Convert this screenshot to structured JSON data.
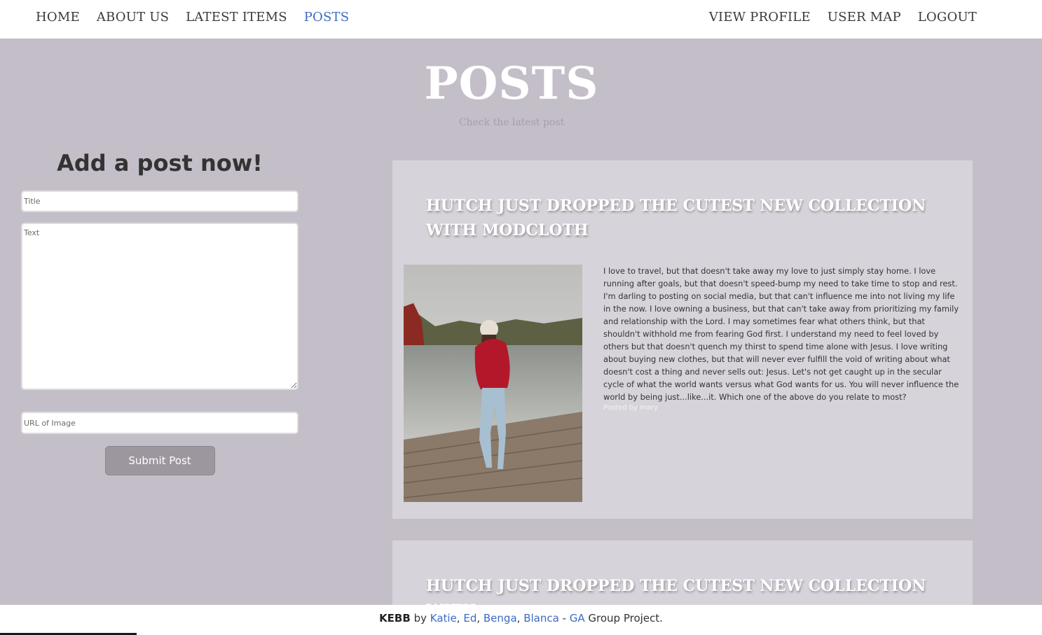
{
  "nav": {
    "left": [
      "HOME",
      "ABOUT US",
      "LATEST ITEMS",
      "POSTS"
    ],
    "right": [
      "VIEW PROFILE",
      "USER MAP",
      "LOGOUT"
    ],
    "active": "POSTS",
    "active_color": "#3c6ac6"
  },
  "hero": {
    "title": "POSTS",
    "subtitle": "Check the latest post"
  },
  "form": {
    "heading": "Add a post now!",
    "title_placeholder": "Title",
    "text_placeholder": "Text",
    "url_placeholder": "URL of Image",
    "submit_label": "Submit Post"
  },
  "posts": [
    {
      "title": "HUTCH JUST DROPPED THE CUTEST NEW COLLECTION WITH MODCLOTH",
      "body": "I love to travel, but that doesn't take away my love to just simply stay home. I love running after goals, but that doesn't speed-bump my need to take time to stop and rest. I'm darling to posting on social media, but that can't influence me into not living my life in the now. I love owning a business, but that can't take away from prioritizing my family and relationship with the Lord. I may sometimes fear what others think, but that shouldn't withhold me from fearing God first. I understand my need to feel loved by others but that doesn't quench my thirst to spend time alone with Jesus. I love writing about buying new clothes, but that will never ever fulfill the void of writing about what doesn't cost a thing and never sells out: Jesus. Let's not get caught up in the secular cycle of what the world wants versus what God wants for us. You will never influence the world by being just...like...it. Which one of the above do you relate to most?",
      "author": "Posted by mary",
      "image_icon": "woman-on-dock-photo"
    },
    {
      "title": "HUTCH JUST DROPPED THE CUTEST NEW COLLECTION WITH"
    }
  ],
  "footer": {
    "brand": "KEBB",
    "by": " by ",
    "authors": [
      "Katie",
      "Ed",
      "Benga",
      "Blanca"
    ],
    "sep": ", ",
    "dash": " - ",
    "ga": "GA",
    "tail": " Group Project."
  },
  "colors": {
    "background": "#c3bec8",
    "card": "#d7d3da",
    "button": "#9c969f",
    "link": "#3c6ac6"
  }
}
